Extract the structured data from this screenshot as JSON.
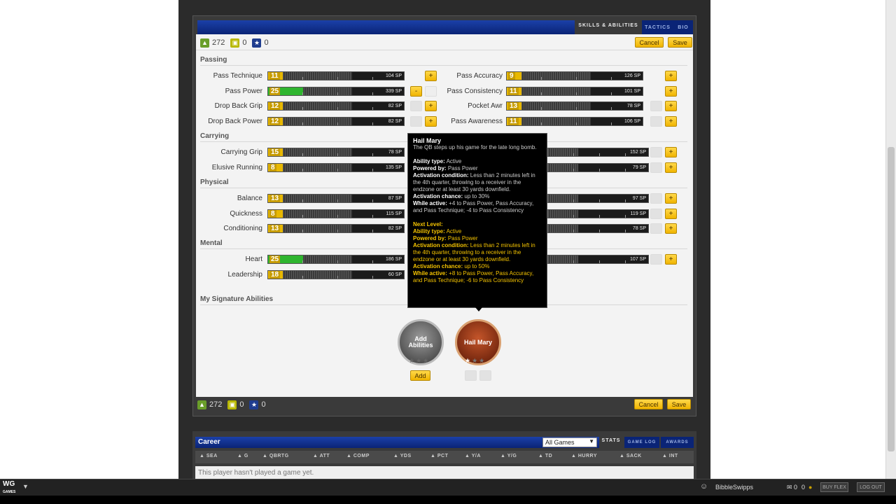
{
  "tabs": {
    "skills": "Skills & Abilities",
    "tactics": "Tactics",
    "bio": "Bio"
  },
  "points": {
    "skill_points": "272",
    "training_points": "0",
    "ability_points": "0"
  },
  "buttons": {
    "cancel": "Cancel",
    "save": "Save",
    "add": "Add",
    "plus": "+",
    "minus": "-"
  },
  "sections": {
    "passing": "Passing",
    "carrying": "Carrying",
    "physical": "Physical",
    "mental": "Mental",
    "signature": "My Signature Abilities"
  },
  "attributes": {
    "pass_technique": {
      "label": "Pass Technique",
      "value": "11",
      "cost": "104 SP",
      "level_pct": 22
    },
    "pass_power": {
      "label": "Pass Power",
      "value": "25",
      "cost": "339 SP",
      "level_pct": 50
    },
    "drop_back_grip": {
      "label": "Drop Back Grip",
      "value": "12",
      "cost": "82 SP",
      "level_pct": 24
    },
    "drop_back_power": {
      "label": "Drop Back Power",
      "value": "12",
      "cost": "82 SP",
      "level_pct": 24
    },
    "pass_accuracy": {
      "label": "Pass Accuracy",
      "value": "9",
      "cost": "126 SP",
      "level_pct": 18
    },
    "pass_consistency": {
      "label": "Pass Consistency",
      "value": "11",
      "cost": "101 SP",
      "level_pct": 22
    },
    "pocket_awr": {
      "label": "Pocket Awr",
      "value": "13",
      "cost": "78 SP",
      "level_pct": 26
    },
    "pass_awareness": {
      "label": "Pass Awareness",
      "value": "11",
      "cost": "106 SP",
      "level_pct": 22
    },
    "carrying_grip": {
      "label": "Carrying Grip",
      "value": "15",
      "cost": "78 SP",
      "level_pct": 30
    },
    "elusive_running": {
      "label": "Elusive Running",
      "value": "8",
      "cost": "135 SP",
      "level_pct": 16
    },
    "carry_right_1": {
      "cost": "152 SP"
    },
    "carry_right_2": {
      "cost": "79 SP"
    },
    "balance": {
      "label": "Balance",
      "value": "13",
      "cost": "87 SP",
      "level_pct": 26
    },
    "quickness": {
      "label": "Quickness",
      "value": "8",
      "cost": "115 SP",
      "level_pct": 16
    },
    "conditioning": {
      "label": "Conditioning",
      "value": "13",
      "cost": "82 SP",
      "level_pct": 26
    },
    "phys_right_1": {
      "cost": "97 SP"
    },
    "phys_right_2": {
      "cost": "119 SP"
    },
    "phys_right_3": {
      "cost": "78 SP"
    },
    "heart": {
      "label": "Heart",
      "value": "25",
      "cost": "186 SP",
      "level_pct": 50
    },
    "leadership": {
      "label": "Leadership",
      "value": "18",
      "cost": "60 SP",
      "level_pct": 36
    },
    "mental_right_1": {
      "cost": "107 SP"
    }
  },
  "tooltip": {
    "title": "Hail Mary",
    "desc": "The QB steps up his game for the late long bomb.",
    "type_label": "Ability type:",
    "type": "Active",
    "powered_label": "Powered by:",
    "powered": "Pass Power",
    "cond_label": "Activation condition:",
    "cond": "Less than 2 minutes left in the 4th quarter, throwing to a receiver in the endzone or at least 30 yards downfield.",
    "chance_label": "Activation chance:",
    "chance": "up to 30%",
    "while_label": "While active:",
    "while": "+4 to Pass Power, Pass Accuracy, and Pass Technique; -4 to Pass Consistency",
    "next_label": "Next Level:",
    "next_type": "Active",
    "next_powered": "Pass Power",
    "next_cond": "Less than 2 minutes left in the 4th quarter, throwing to a receiver in the endzone or at least 30 yards downfield.",
    "next_chance": "up to 50%",
    "next_while": "+8 to Pass Power, Pass Accuracy, and Pass Technique; -6 to Pass Consistency"
  },
  "abilities": {
    "add": "Add Abilities",
    "hail_mary": "Hail Mary"
  },
  "career": {
    "title": "Career",
    "filter": "All Games",
    "tabs": {
      "stats": "Stats",
      "game_log": "Game Log",
      "awards": "Awards"
    },
    "columns": [
      "SEA",
      "G",
      "QBRTG",
      "ATT",
      "COMP",
      "YDS",
      "PCT",
      "Y/A",
      "Y/G",
      "TD",
      "HURRY",
      "SACK",
      "INT"
    ],
    "empty": "This player hasn't played a game yet."
  },
  "taskbar": {
    "username": "BibbleSwipps",
    "mail_count": "0",
    "coin_count": "0",
    "buy_flex": "BUY FLEX",
    "logout": "LOG OUT"
  },
  "colors": {
    "accent_yellow": "#f0b400",
    "bar_blue": "#0a2476",
    "green": "#2fb52f"
  }
}
